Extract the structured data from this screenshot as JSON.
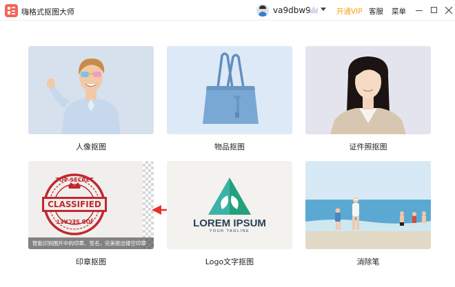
{
  "app": {
    "title": "嗨格式抠图大师"
  },
  "header": {
    "username": "va9dbw9",
    "vip_label": "开通VIP",
    "service_label": "客服",
    "menu_label": "菜单"
  },
  "colors": {
    "brand": "#f2665b",
    "vip": "#f5a312",
    "arrow": "#e8302a",
    "stamp": "#c0282e"
  },
  "cards": [
    {
      "label": "人像抠图",
      "icon": "portrait-photo"
    },
    {
      "label": "物品抠图",
      "icon": "handbag-photo"
    },
    {
      "label": "证件照抠图",
      "icon": "id-photo"
    },
    {
      "label": "印章抠图",
      "icon": "stamp-photo",
      "stamp_top": "TOP SECRET",
      "stamp_center": "CLASSIFIED",
      "stamp_bottom": "JOB SECRET",
      "caption": "智能识别图片中的印章、签名，完美抠出镂空印章"
    },
    {
      "label": "Logo文字抠图",
      "icon": "logo-photo",
      "logo_text": "LOREM IPSUM",
      "logo_tagline": "YOUR TAGLINE"
    },
    {
      "label": "消除笔",
      "icon": "beach-photo"
    }
  ]
}
